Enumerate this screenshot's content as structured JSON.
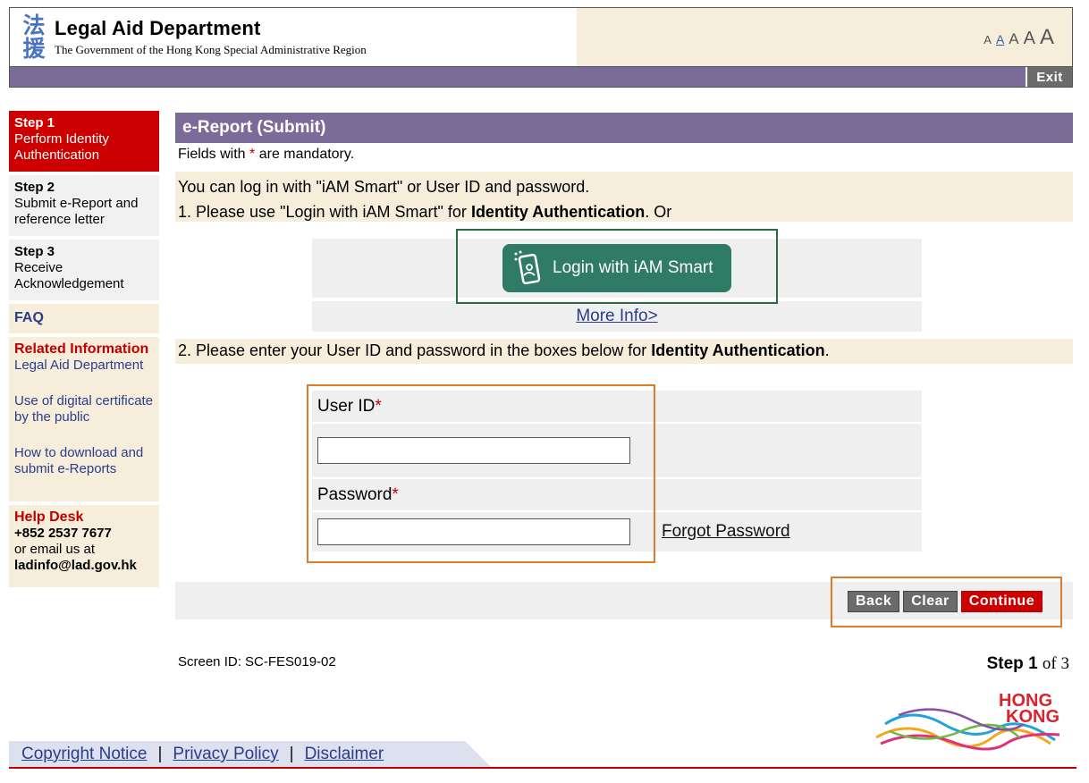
{
  "header": {
    "logo_chars": [
      "法",
      "援"
    ],
    "dept_title": "Legal Aid Department",
    "dept_subtitle": "The Government of the Hong Kong Special Administrative Region",
    "font_sizes": [
      "A",
      "A",
      "A",
      "A",
      "A"
    ],
    "exit_label": "Exit"
  },
  "sidebar": {
    "step1": {
      "title": "Step 1",
      "text": "Perform Identity Authentication"
    },
    "step2": {
      "title": "Step 2",
      "text": "Submit e-Report and reference letter"
    },
    "step3": {
      "title": "Step 3",
      "text": "Receive Acknowledgement"
    },
    "faq": "FAQ",
    "related": {
      "title": "Related Information",
      "links": [
        "Legal Aid Department",
        "Use of digital certificate by the public",
        "How to download and submit e-Reports"
      ]
    },
    "helpdesk": {
      "title": "Help Desk",
      "phone": "+852 2537 7677",
      "email_text": "or email us at",
      "email": "ladinfo@lad.gov.hk"
    }
  },
  "main": {
    "title": "e-Report (Submit)",
    "mandatory_prefix": "Fields with",
    "mandatory_star": "*",
    "mandatory_suffix": "are mandatory.",
    "intro_line1": "You can log in with \"iAM Smart\" or User ID and password.",
    "intro_line2_prefix": "1. Please use \"Login with iAM Smart\" for",
    "intro_line2_bold": "Identity Authentication",
    "intro_line2_suffix": ". Or",
    "iam_button": "Login with iAM Smart",
    "more_info": "More Info>",
    "step2_prefix": "2. Please enter your User ID and password in the boxes below for",
    "step2_bold": "Identity Authentication",
    "step2_suffix": ".",
    "userid_label": "User ID",
    "password_label": "Password",
    "required_star": "*",
    "userid_value": "",
    "password_value": "",
    "forgot_password": "Forgot Password",
    "btn_back": "Back",
    "btn_clear": "Clear",
    "btn_continue": "Continue",
    "screen_id": "Screen ID: SC-FES019-02",
    "step_label": "Step",
    "step_current": "1",
    "step_total": "of 3"
  },
  "footer": {
    "copyright": "Copyright Notice",
    "privacy": "Privacy Policy",
    "disclaimer": "Disclaimer",
    "separator": "|",
    "hk_logo_line1": "HONG",
    "hk_logo_line2": "KONG"
  },
  "colors": {
    "purple": "#7b6b99",
    "red": "#cc0000",
    "beige": "#f6eedb",
    "iam_green": "#2f7b66",
    "highlight_orange": "#e07c25"
  }
}
